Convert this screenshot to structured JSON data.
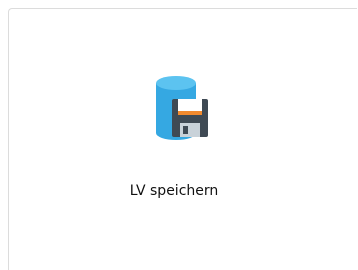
{
  "tile": {
    "label": "LV speichern",
    "icon": "database-save-icon"
  },
  "colors": {
    "database": "#35a8e2",
    "database_top": "#5cc3f0",
    "disk_body": "#3f4a54",
    "disk_label_stripe": "#f28a2e",
    "disk_label": "#ffffff",
    "disk_slot": "#c9d2d9"
  }
}
